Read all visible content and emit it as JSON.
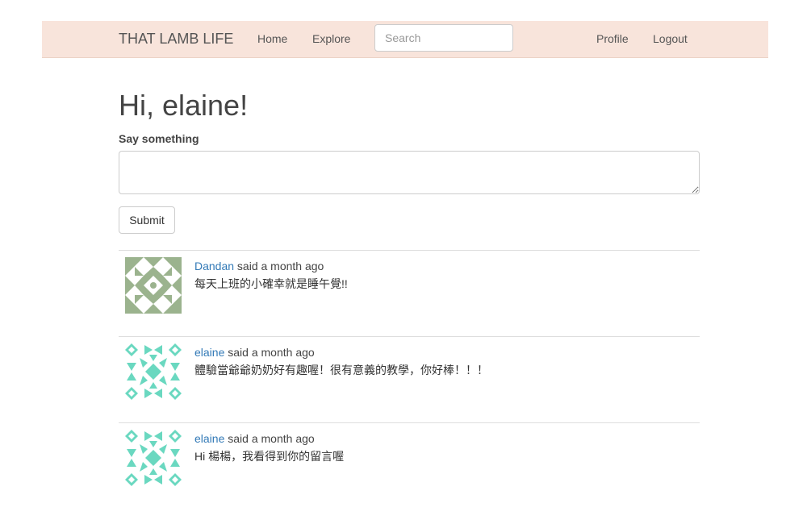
{
  "nav": {
    "brand": "THAT LAMB LIFE",
    "home": "Home",
    "explore": "Explore",
    "search_placeholder": "Search",
    "profile": "Profile",
    "logout": "Logout"
  },
  "main": {
    "greeting": "Hi, elaine!",
    "form_label": "Say something",
    "textarea_value": "",
    "submit_label": "Submit"
  },
  "posts": [
    {
      "author": "Dandan",
      "said": " said a month ago",
      "body": "每天上班的小確幸就是睡午覺!!",
      "avatar_icon": "identicon-green",
      "avatar_color": "#9bb38e"
    },
    {
      "author": "elaine",
      "said": " said a month ago",
      "body": "體驗當爺爺奶奶好有趣喔！很有意義的教學，你好棒！！！",
      "avatar_icon": "identicon-teal",
      "avatar_color": "#6ad8c0"
    },
    {
      "author": "elaine",
      "said": " said a month ago",
      "body": "Hi 楊楊，我看得到你的留言喔",
      "avatar_icon": "identicon-teal",
      "avatar_color": "#6ad8c0"
    }
  ],
  "colors": {
    "navbar_bg": "#f8e4db",
    "link": "#337ab7"
  }
}
